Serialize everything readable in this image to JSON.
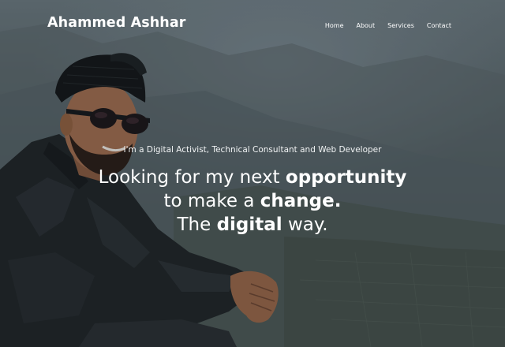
{
  "brand": {
    "name": "Ahammed Ashhar"
  },
  "nav": {
    "items": [
      {
        "label": "Home"
      },
      {
        "label": "About"
      },
      {
        "label": "Services"
      },
      {
        "label": "Contact"
      }
    ]
  },
  "hero": {
    "intro": "I'm a Digital Activist, Technical Consultant and Web Developer",
    "line1_pre": "Looking for my next ",
    "line1_bold": "opportunity",
    "line2_pre": "to make a ",
    "line2_bold": "change.",
    "line3_pre": "The ",
    "line3_bold": "digital",
    "line3_post": " way."
  },
  "colors": {
    "sky": "#6d7a80",
    "valley": "#454d4c",
    "text": "#ffffff"
  }
}
